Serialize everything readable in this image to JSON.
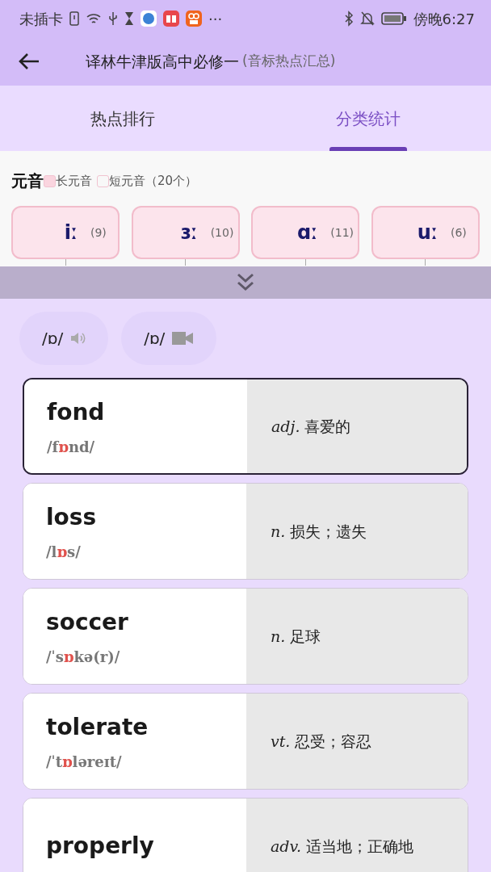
{
  "status_bar": {
    "carrier": "未插卡",
    "more": "···",
    "time": "傍晚6:27"
  },
  "header": {
    "title": "译林牛津版高中必修一",
    "subtitle": "(音标热点汇总)"
  },
  "tabs": [
    {
      "label": "热点排行",
      "selected": false
    },
    {
      "label": "分类统计",
      "selected": true
    }
  ],
  "category": {
    "title": "元音",
    "legend": [
      {
        "label": "长元音",
        "checked": true
      },
      {
        "label": "短元音",
        "checked": false
      }
    ],
    "count": "（20个）"
  },
  "phonemes": [
    {
      "symbol": "iː",
      "count": "(9)"
    },
    {
      "symbol": "ɜː",
      "count": "(10)"
    },
    {
      "symbol": "ɑː",
      "count": "(11)"
    },
    {
      "symbol": "uː",
      "count": "(6)"
    }
  ],
  "media_buttons": [
    {
      "label": "/ɒ/",
      "kind": "audio"
    },
    {
      "label": "/ɒ/",
      "kind": "video"
    }
  ],
  "words": [
    {
      "word": "fond",
      "phonetic": {
        "before": "/f",
        "highlight": "ɒ",
        "after": "nd/"
      },
      "pos": "adj.",
      "meaning": "喜爱的",
      "selected": true
    },
    {
      "word": "loss",
      "phonetic": {
        "before": "/l",
        "highlight": "ɒ",
        "after": "s/"
      },
      "pos": "n.",
      "meaning": "损失；遗失",
      "selected": false
    },
    {
      "word": "soccer",
      "phonetic": {
        "before": "/ˈs",
        "highlight": "ɒ",
        "after": "kə(r)/"
      },
      "pos": "n.",
      "meaning": "足球",
      "selected": false
    },
    {
      "word": "tolerate",
      "phonetic": {
        "before": "/ˈt",
        "highlight": "ɒ",
        "after": "ləreɪt/"
      },
      "pos": "vt.",
      "meaning": "忍受；容忍",
      "selected": false
    },
    {
      "word": "properly",
      "pos": "adv.",
      "meaning": "适当地；正确地",
      "selected": false
    }
  ]
}
